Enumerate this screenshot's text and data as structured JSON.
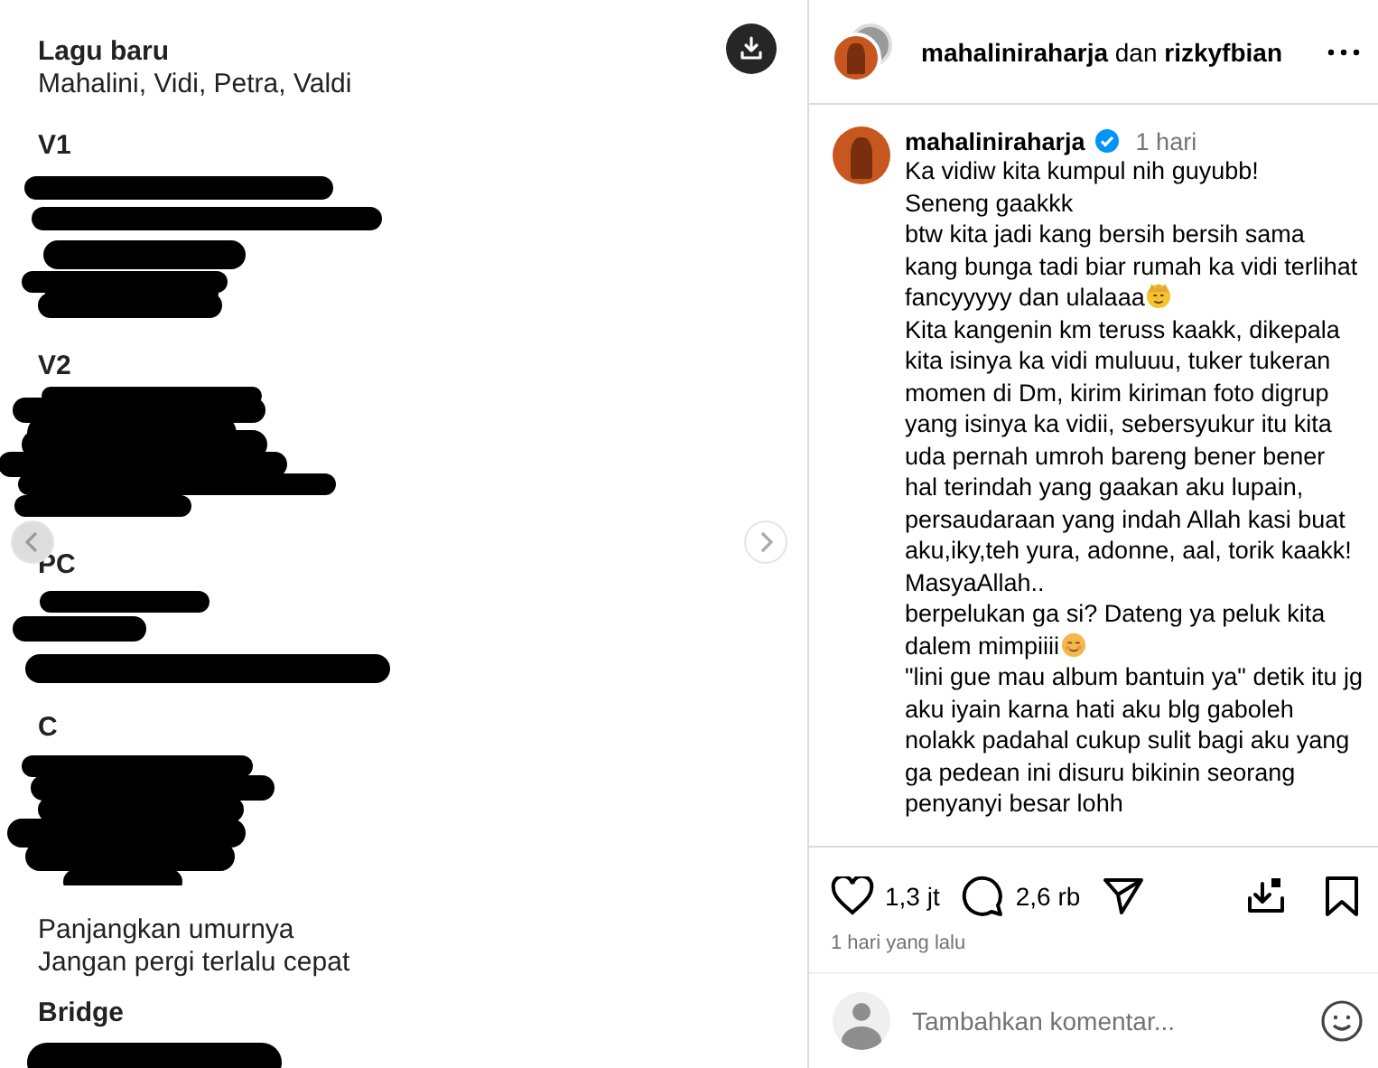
{
  "post_image": {
    "kind": "document",
    "title": "Lagu baru",
    "subtitle": "Mahalini, Vidi, Petra, Valdi",
    "sections": [
      {
        "heading": "V1",
        "redacted": true
      },
      {
        "heading": "V2",
        "redacted": true
      },
      {
        "heading": "PC",
        "redacted": true
      },
      {
        "heading": "C",
        "redacted": true,
        "lines": [
          "Panjangkan umurnya",
          "Jangan pergi terlalu cepat"
        ]
      },
      {
        "heading": "Bridge",
        "redacted": true
      }
    ],
    "has_prev": true,
    "has_next": true
  },
  "header": {
    "authors": "**mahaliniraharja** dan **rizkyfbian**"
  },
  "caption": {
    "username": "mahaliniraharja",
    "verified": true,
    "time": "1 hari",
    "paragraphs": [
      {
        "kind": "plain",
        "text": "Ka vidiw kita kumpul nih guyubb!"
      },
      {
        "kind": "plain",
        "text": "Seneng gaakkk"
      },
      {
        "kind": "smirk",
        "text": "btw kita jadi kang bersih bersih sama kang bunga tadi biar rumah ka vidi terlihat fancyyyyy dan ulalaaa"
      },
      {
        "kind": "plain",
        "text": "Kita kangenin km teruss kaakk, dikepala kita isinya ka vidi muluuu, tuker tukeran momen di Dm, kirim kiriman foto digrup yang isinya ka vidii, sebersyukur itu kita uda pernah umroh bareng bener bener hal terindah yang gaakan aku lupain, persaudaraan yang indah Allah kasi buat aku,iky,teh yura, adonne, aal, torik kaakk! MasyaAllah.."
      },
      {
        "kind": "blush",
        "text": "berpelukan ga si? Dateng ya peluk kita dalem mimpiiii"
      },
      {
        "kind": "plain",
        "text": "\"lini gue mau album bantuin ya\" detik itu jg aku iyain karna hati aku blg gaboleh nolakk padahal cukup sulit bagi aku yang ga pedean ini disuru bikinin seorang penyanyi besar lohh"
      }
    ]
  },
  "actions": {
    "likes": "1,3 jt",
    "liked": false,
    "comments": "2,6 rb",
    "saved": false
  },
  "date": "1 hari yang lalu",
  "comment_box": {
    "placeholder": "Tambahkan komentar..."
  }
}
